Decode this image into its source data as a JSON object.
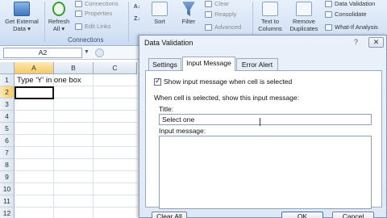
{
  "ribbon": {
    "get_external": {
      "line1": "Get External",
      "line2": "Data ▾"
    },
    "refresh": {
      "line1": "Refresh",
      "line2": "All ▾"
    },
    "connections_btn": "Connections",
    "properties_btn": "Properties",
    "edit_links_btn": "Edit Links",
    "connections_group": "Connections",
    "sort_btn": "Sort",
    "filter_btn": "Filter",
    "clear_btn": "Clear",
    "reapply_btn": "Reapply",
    "advanced_btn": "Advanced",
    "text_to_columns": {
      "line1": "Text to",
      "line2": "Columns"
    },
    "remove_duplicates": {
      "line1": "Remove",
      "line2": "Duplicates"
    },
    "data_validation_btn": "Data Validation",
    "consolidate_btn": "Consolidate",
    "what_if_btn": "What-If Analysis"
  },
  "formula_bar": {
    "name_box": "A2"
  },
  "sheet": {
    "columns": [
      "A",
      "B",
      "C"
    ],
    "rows": [
      "1",
      "2",
      "3",
      "4",
      "5",
      "6",
      "7",
      "8",
      "9",
      "10",
      "11",
      "12"
    ],
    "a1_text": "Type 'Y' in one box"
  },
  "dialog": {
    "title": "Data Validation",
    "help": "?",
    "close": "✕",
    "tabs": [
      "Settings",
      "Input Message",
      "Error Alert"
    ],
    "show_checkbox_label": "Show input message when cell is selected",
    "checked": true,
    "section_label": "When cell is selected, show this input message:",
    "title_label": "Title:",
    "title_value": "Select one",
    "message_label": "Input message:",
    "message_value": "",
    "clear_all": "Clear All",
    "ok": "OK",
    "cancel": "Cancel"
  },
  "colors": {
    "ribbon_bg": "#d5e3f5",
    "selection_header": "#f7c964",
    "dialog_bg": "#dfe9f6"
  }
}
